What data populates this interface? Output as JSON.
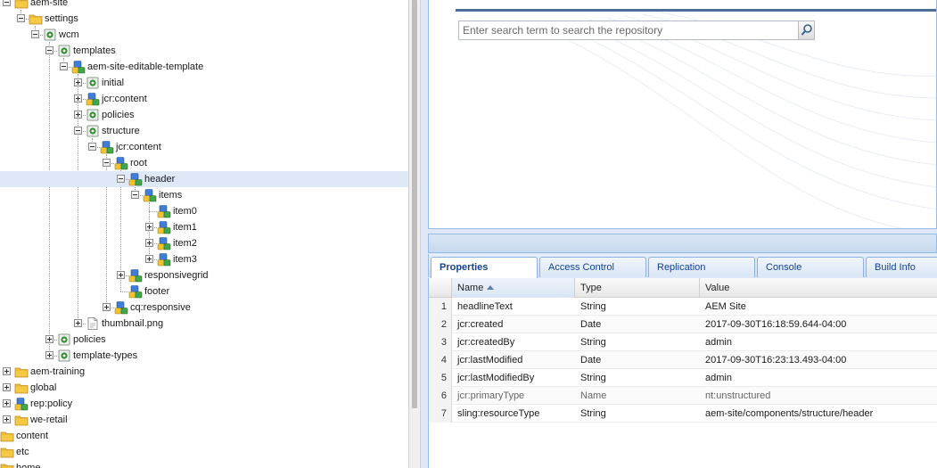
{
  "tree": {
    "nodes": [
      {
        "label": "aem-site",
        "depth": 0,
        "expander": "minus",
        "icon": "folder"
      },
      {
        "label": "settings",
        "depth": 1,
        "expander": "minus",
        "icon": "folder"
      },
      {
        "label": "wcm",
        "depth": 2,
        "expander": "minus",
        "icon": "page"
      },
      {
        "label": "templates",
        "depth": 3,
        "expander": "minus",
        "icon": "page"
      },
      {
        "label": "aem-site-editable-template",
        "depth": 4,
        "expander": "minus",
        "icon": "node"
      },
      {
        "label": "initial",
        "depth": 5,
        "expander": "plus",
        "icon": "page"
      },
      {
        "label": "jcr:content",
        "depth": 5,
        "expander": "plus",
        "icon": "node"
      },
      {
        "label": "policies",
        "depth": 5,
        "expander": "plus",
        "icon": "page"
      },
      {
        "label": "structure",
        "depth": 5,
        "expander": "minus",
        "icon": "page"
      },
      {
        "label": "jcr:content",
        "depth": 6,
        "expander": "minus",
        "icon": "node"
      },
      {
        "label": "root",
        "depth": 7,
        "expander": "minus",
        "icon": "node"
      },
      {
        "label": "header",
        "depth": 8,
        "expander": "minus",
        "icon": "node",
        "selected": true
      },
      {
        "label": "items",
        "depth": 9,
        "expander": "minus",
        "icon": "node"
      },
      {
        "label": "item0",
        "depth": 10,
        "expander": "none",
        "icon": "node"
      },
      {
        "label": "item1",
        "depth": 10,
        "expander": "plus",
        "icon": "node"
      },
      {
        "label": "item2",
        "depth": 10,
        "expander": "plus",
        "icon": "node"
      },
      {
        "label": "item3",
        "depth": 10,
        "expander": "plus",
        "icon": "node"
      },
      {
        "label": "responsivegrid",
        "depth": 8,
        "expander": "plus",
        "icon": "node"
      },
      {
        "label": "footer",
        "depth": 8,
        "expander": "none",
        "icon": "node"
      },
      {
        "label": "cq:responsive",
        "depth": 7,
        "expander": "plus",
        "icon": "node"
      },
      {
        "label": "thumbnail.png",
        "depth": 5,
        "expander": "plus",
        "icon": "file"
      },
      {
        "label": "policies",
        "depth": 3,
        "expander": "plus",
        "icon": "page"
      },
      {
        "label": "template-types",
        "depth": 3,
        "expander": "plus",
        "icon": "page"
      },
      {
        "label": "aem-training",
        "depth": 0,
        "expander": "plus",
        "icon": "folder"
      },
      {
        "label": "global",
        "depth": 0,
        "expander": "plus",
        "icon": "folder"
      },
      {
        "label": "rep:policy",
        "depth": 0,
        "expander": "plus",
        "icon": "node"
      },
      {
        "label": "we-retail",
        "depth": 0,
        "expander": "plus",
        "icon": "folder"
      },
      {
        "label": "content",
        "depth": -1,
        "expander": "none",
        "icon": "folder"
      },
      {
        "label": "etc",
        "depth": -1,
        "expander": "none",
        "icon": "folder"
      },
      {
        "label": "home",
        "depth": -1,
        "expander": "none",
        "icon": "folder"
      }
    ]
  },
  "search": {
    "placeholder": "Enter search term to search the repository",
    "button_icon": "magnifier-icon"
  },
  "tabs": [
    {
      "label": "Properties",
      "active": true
    },
    {
      "label": "Access Control",
      "active": false
    },
    {
      "label": "Replication",
      "active": false
    },
    {
      "label": "Console",
      "active": false
    },
    {
      "label": "Build Info",
      "active": false
    }
  ],
  "grid": {
    "columns": [
      "Name",
      "Type",
      "Value"
    ],
    "sorted_column": "Name",
    "rows": [
      {
        "num": "1",
        "name": "headlineText",
        "type": "String",
        "value": "AEM Site",
        "muted": false
      },
      {
        "num": "2",
        "name": "jcr:created",
        "type": "Date",
        "value": "2017-09-30T16:18:59.644-04:00",
        "muted": false
      },
      {
        "num": "3",
        "name": "jcr:createdBy",
        "type": "String",
        "value": "admin",
        "muted": false
      },
      {
        "num": "4",
        "name": "jcr:lastModified",
        "type": "Date",
        "value": "2017-09-30T16:23:13.493-04:00",
        "muted": false
      },
      {
        "num": "5",
        "name": "jcr:lastModifiedBy",
        "type": "String",
        "value": "admin",
        "muted": false
      },
      {
        "num": "6",
        "name": "jcr:primaryType",
        "type": "Name",
        "value": "nt:unstructured",
        "muted": true
      },
      {
        "num": "7",
        "name": "sling:resourceType",
        "type": "String",
        "value": "aem-site/components/structure/header",
        "muted": false
      }
    ]
  },
  "colors": {
    "selection": "#dfe8f6",
    "panel_border": "#99bbe8",
    "tab_text": "#15428b",
    "folder": "#f5c542"
  }
}
